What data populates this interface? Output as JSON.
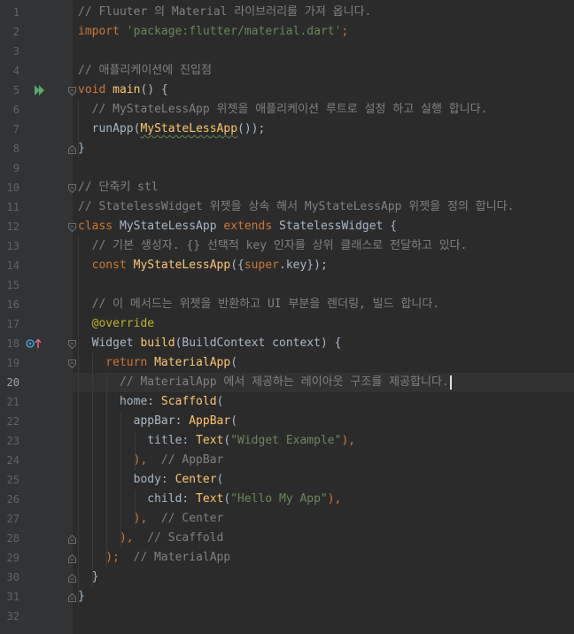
{
  "editor": {
    "current_line": 20,
    "lines": [
      {
        "n": "1",
        "tokens": [
          {
            "t": "// Fluuter 의 Material 라이브러리를 가져 옵니다.",
            "c": "t-comment"
          }
        ]
      },
      {
        "n": "2",
        "tokens": [
          {
            "t": "import ",
            "c": "t-kw"
          },
          {
            "t": "'package:flutter/material.dart'",
            "c": "t-str"
          },
          {
            "t": ";",
            "c": "t-kw"
          }
        ]
      },
      {
        "n": "3",
        "tokens": []
      },
      {
        "n": "4",
        "tokens": [
          {
            "t": "// 애플리케이션에 진입점",
            "c": "t-comment"
          }
        ]
      },
      {
        "n": "5",
        "tokens": [
          {
            "t": "void ",
            "c": "t-kw"
          },
          {
            "t": "main",
            "c": "t-fn"
          },
          {
            "t": "() {",
            "c": "t-plain"
          }
        ]
      },
      {
        "n": "6",
        "tokens": [
          {
            "t": "  // MyStateLessApp 위젯을 애플리케이션 루트로 설정 하고 실행 합니다.",
            "c": "t-comment"
          }
        ]
      },
      {
        "n": "7",
        "tokens": [
          {
            "t": "  runApp(",
            "c": "t-plain"
          },
          {
            "t": "MyStateLessApp",
            "c": "t-fn wavy"
          },
          {
            "t": "());",
            "c": "t-plain"
          }
        ]
      },
      {
        "n": "8",
        "tokens": [
          {
            "t": "}",
            "c": "t-plain"
          }
        ]
      },
      {
        "n": "9",
        "tokens": []
      },
      {
        "n": "10",
        "tokens": [
          {
            "t": "// 단축키 stl",
            "c": "t-comment"
          }
        ]
      },
      {
        "n": "11",
        "tokens": [
          {
            "t": "// StatelessWidget 위젯을 상속 해서 MyStateLessApp 위젯을 정의 합니다.",
            "c": "t-comment"
          }
        ]
      },
      {
        "n": "12",
        "tokens": [
          {
            "t": "class ",
            "c": "t-kw"
          },
          {
            "t": "MyStateLessApp ",
            "c": "t-plain"
          },
          {
            "t": "extends ",
            "c": "t-kw"
          },
          {
            "t": "StatelessWidget {",
            "c": "t-plain"
          }
        ]
      },
      {
        "n": "13",
        "tokens": [
          {
            "t": "  // 기본 생성자. {} 선택적 key 인자를 상위 클래스로 전달하고 있다.",
            "c": "t-comment"
          }
        ]
      },
      {
        "n": "14",
        "tokens": [
          {
            "t": "  const ",
            "c": "t-kw"
          },
          {
            "t": "MyStateLessApp",
            "c": "t-fn"
          },
          {
            "t": "({",
            "c": "t-plain"
          },
          {
            "t": "super",
            "c": "t-super"
          },
          {
            "t": ".key});",
            "c": "t-plain"
          }
        ]
      },
      {
        "n": "15",
        "tokens": []
      },
      {
        "n": "16",
        "tokens": [
          {
            "t": "  // 이 메서드는 위젯을 반환하고 UI 부분을 렌더링, 빌드 합니다.",
            "c": "t-comment"
          }
        ]
      },
      {
        "n": "17",
        "tokens": [
          {
            "t": "  @override",
            "c": "t-ann"
          }
        ]
      },
      {
        "n": "18",
        "tokens": [
          {
            "t": "  Widget ",
            "c": "t-plain"
          },
          {
            "t": "build",
            "c": "t-fn"
          },
          {
            "t": "(BuildContext context) {",
            "c": "t-plain"
          }
        ]
      },
      {
        "n": "19",
        "tokens": [
          {
            "t": "    return ",
            "c": "t-kw"
          },
          {
            "t": "MaterialApp",
            "c": "t-fn"
          },
          {
            "t": "(",
            "c": "t-plain"
          }
        ]
      },
      {
        "n": "20",
        "tokens": [
          {
            "t": "      // MaterialApp 에서 제공하는 레이아웃 구조를 제공합니다.",
            "c": "t-comment"
          }
        ]
      },
      {
        "n": "21",
        "tokens": [
          {
            "t": "      home: ",
            "c": "t-plain"
          },
          {
            "t": "Scaffold",
            "c": "t-fn"
          },
          {
            "t": "(",
            "c": "t-plain"
          }
        ]
      },
      {
        "n": "22",
        "tokens": [
          {
            "t": "        appBar: ",
            "c": "t-plain"
          },
          {
            "t": "AppBar",
            "c": "t-fn"
          },
          {
            "t": "(",
            "c": "t-plain"
          }
        ]
      },
      {
        "n": "23",
        "tokens": [
          {
            "t": "          title: ",
            "c": "t-plain"
          },
          {
            "t": "Text",
            "c": "t-fn"
          },
          {
            "t": "(",
            "c": "t-plain"
          },
          {
            "t": "\"Widget Example\"",
            "c": "t-str"
          },
          {
            "t": "),",
            "c": "t-kw"
          }
        ]
      },
      {
        "n": "24",
        "tokens": [
          {
            "t": "        ),  ",
            "c": "t-kw"
          },
          {
            "t": "// AppBar",
            "c": "t-comment"
          }
        ]
      },
      {
        "n": "25",
        "tokens": [
          {
            "t": "        body: ",
            "c": "t-plain"
          },
          {
            "t": "Center",
            "c": "t-fn"
          },
          {
            "t": "(",
            "c": "t-plain"
          }
        ]
      },
      {
        "n": "26",
        "tokens": [
          {
            "t": "          child: ",
            "c": "t-plain"
          },
          {
            "t": "Text",
            "c": "t-fn"
          },
          {
            "t": "(",
            "c": "t-plain"
          },
          {
            "t": "\"Hello My App\"",
            "c": "t-str"
          },
          {
            "t": "),",
            "c": "t-kw"
          }
        ]
      },
      {
        "n": "27",
        "tokens": [
          {
            "t": "        ),  ",
            "c": "t-kw"
          },
          {
            "t": "// Center",
            "c": "t-comment"
          }
        ]
      },
      {
        "n": "28",
        "tokens": [
          {
            "t": "      ),  ",
            "c": "t-kw"
          },
          {
            "t": "// Scaffold",
            "c": "t-comment"
          }
        ]
      },
      {
        "n": "29",
        "tokens": [
          {
            "t": "    );  ",
            "c": "t-kw"
          },
          {
            "t": "// MaterialApp",
            "c": "t-comment"
          }
        ]
      },
      {
        "n": "30",
        "tokens": [
          {
            "t": "  }",
            "c": "t-plain"
          }
        ]
      },
      {
        "n": "31",
        "tokens": [
          {
            "t": "}",
            "c": "t-plain"
          }
        ]
      },
      {
        "n": "32",
        "tokens": []
      }
    ]
  },
  "colors": {
    "background": "#2b2b2b",
    "gutter": "#313335",
    "comment": "#808080",
    "keyword": "#cc7832",
    "string": "#6a8759",
    "function": "#ffc66d",
    "annotation": "#bbb529",
    "plain": "#a9b7c6"
  },
  "gutter_icons": {
    "run_line": "run-icon",
    "override_line": "override-marker-icon"
  }
}
